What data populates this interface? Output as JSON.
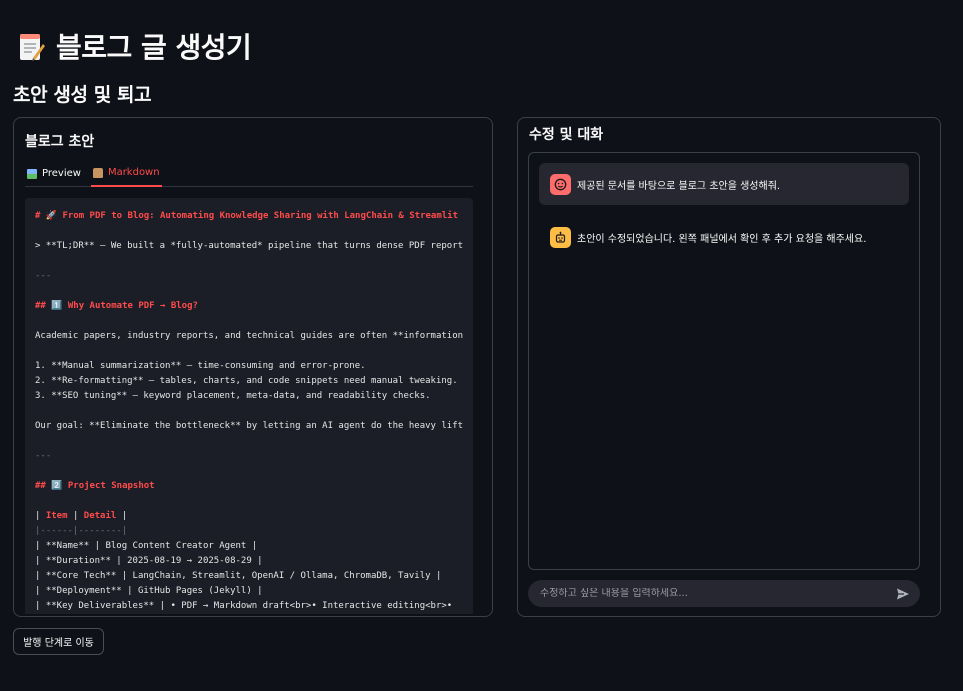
{
  "app": {
    "title": "블로그 글 생성기",
    "title_icon": "memo-icon"
  },
  "section": {
    "title": "초안 생성 및 퇴고"
  },
  "left_panel": {
    "title": "블로그 초안",
    "tabs": [
      {
        "label": "Preview",
        "icon": "picture-icon",
        "active": false
      },
      {
        "label": "Markdown",
        "icon": "scroll-icon",
        "active": true
      }
    ],
    "markdown": {
      "l1": "# 🚀 From PDF to Blog: Automating Knowledge Sharing with LangChain & Streamlit",
      "l2": "> **TL;DR** – We built a *fully-automated* pipeline that turns dense PDF reports",
      "l3": "---",
      "l4": "## 1️⃣ Why Automate PDF → Blog?",
      "l5": "Academic papers, industry reports, and technical guides are often **information",
      "l6": "1. **Manual summarization** – time-consuming and error-prone.",
      "l7": "2. **Re-formatting** – tables, charts, and code snippets need manual tweaking.",
      "l8": "3. **SEO tuning** – keyword placement, meta-data, and readability checks.",
      "l9": "Our goal: **Eliminate the bottleneck** by letting an AI agent do the heavy lifting",
      "l10": "---",
      "l11": "## 2️⃣ Project Snapshot",
      "l12_a": "| ",
      "l12_b": "Item",
      "l12_c": " | ",
      "l12_d": "Detail",
      "l12_e": " |",
      "l13": "|------|--------|",
      "l14": "| **Name** | Blog Content Creator Agent |",
      "l15": "| **Duration** | 2025-08-19 → 2025-08-29 |",
      "l16": "| **Core Tech** | LangChain, Streamlit, OpenAI / Ollama, ChromaDB, Tavily |",
      "l17": "| **Deployment** | GitHub Pages (Jekyll) |",
      "l18": "| **Key Deliverables** | • PDF → Markdown draft<br>• Interactive editing<br>•"
    }
  },
  "right_panel": {
    "title": "수정 및 대화",
    "messages": [
      {
        "role": "user",
        "avatar_icon": "user-face-icon",
        "text": "제공된 문서를 바탕으로 블로그 초안을 생성해줘."
      },
      {
        "role": "assistant",
        "avatar_icon": "robot-icon",
        "text": "초안이 수정되었습니다. 왼쪽 패널에서 확인 후 추가 요청을 해주세요."
      }
    ],
    "input": {
      "placeholder": "수정하고 싶은 내용을 입력하세요...",
      "value": ""
    },
    "send_icon": "send-icon"
  },
  "footer": {
    "next_button_label": "발행 단계로 이동"
  },
  "colors": {
    "background": "#0e1117",
    "accent": "#ff4b4b",
    "card": "#262730",
    "code_bg": "#1b1e27"
  }
}
